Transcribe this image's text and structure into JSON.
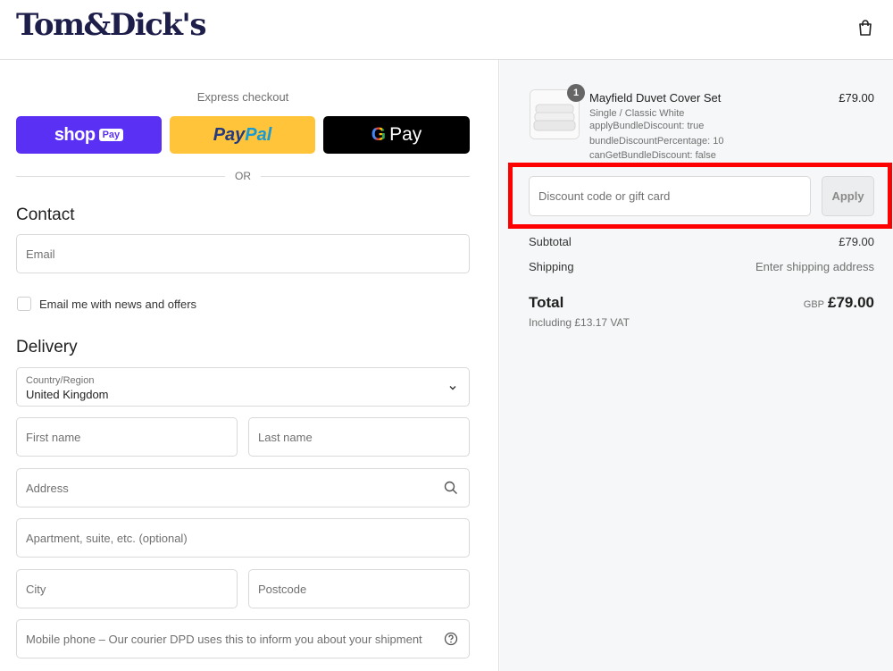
{
  "brand": {
    "logo_text": "Tom&Dick's"
  },
  "header": {
    "cart_icon": "shopping-bag-icon"
  },
  "express": {
    "label": "Express checkout",
    "shop_pay": {
      "word": "shop",
      "badge": "Pay",
      "color": "#5a31f4"
    },
    "paypal": {
      "part1": "Pay",
      "part2": "Pal",
      "color": "#ffc439"
    },
    "gpay": {
      "g": "G",
      "word": "Pay",
      "color": "#000000"
    },
    "or_text": "OR"
  },
  "contact": {
    "title": "Contact",
    "email_placeholder": "Email",
    "newsletter_label": "Email me with news and offers"
  },
  "delivery": {
    "title": "Delivery",
    "country_label": "Country/Region",
    "country_value": "United Kingdom",
    "first_name_placeholder": "First name",
    "last_name_placeholder": "Last name",
    "address_placeholder": "Address",
    "apartment_placeholder": "Apartment, suite, etc. (optional)",
    "city_placeholder": "City",
    "postcode_placeholder": "Postcode",
    "phone_placeholder": "Mobile phone – Our courier DPD uses this to inform you about your shipment"
  },
  "order": {
    "item": {
      "quantity": "1",
      "name": "Mayfield Duvet Cover Set",
      "variant": "Single / Classic White",
      "meta": [
        "applyBundleDiscount: true",
        "bundleDiscountPercentage: 10",
        "canGetBundleDiscount: false"
      ],
      "price": "£79.00"
    },
    "discount_placeholder": "Discount code or gift card",
    "apply_label": "Apply",
    "subtotal_label": "Subtotal",
    "subtotal_value": "£79.00",
    "shipping_label": "Shipping",
    "shipping_value": "Enter shipping address",
    "total_label": "Total",
    "total_currency": "GBP",
    "total_value": "£79.00",
    "vat_text": "Including £13.17 VAT"
  },
  "colors": {
    "highlight": "#ff0000",
    "brand_navy": "#1e1e4a"
  }
}
